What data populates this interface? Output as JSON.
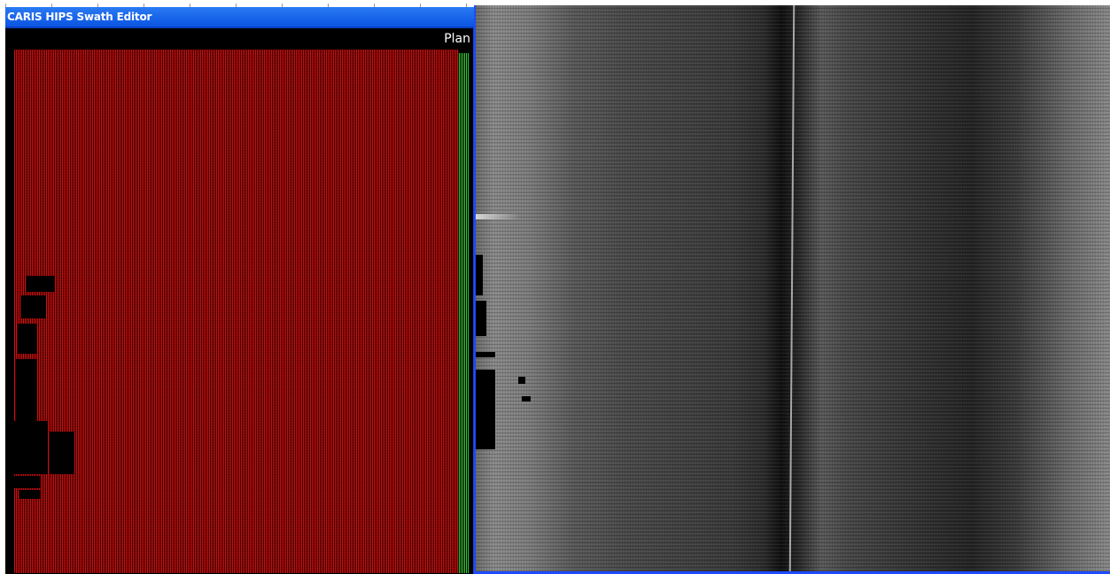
{
  "window": {
    "title": "CARIS HIPS Swath Editor",
    "accent_color": "#0b55e3"
  },
  "plan_view": {
    "label": "Plan",
    "sounding_color": "#cc1010",
    "edge_color": "#33cc33"
  },
  "image_view": {
    "border_color": "#1e4bff"
  }
}
